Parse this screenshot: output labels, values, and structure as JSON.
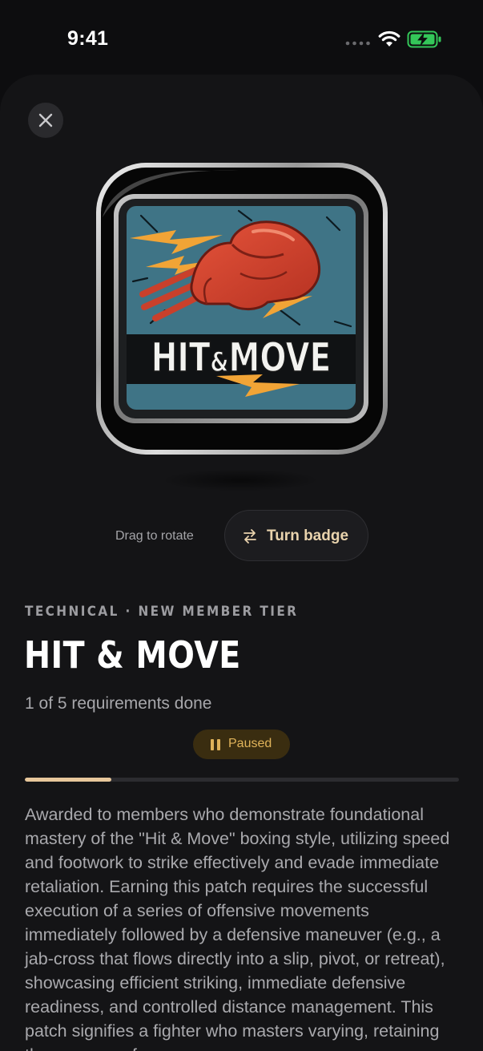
{
  "status_bar": {
    "time": "9:41"
  },
  "close_button": {
    "icon": "close-icon"
  },
  "badge": {
    "text_left": "HIT",
    "text_amp": "&",
    "text_right": "MOVE"
  },
  "rotate": {
    "hint": "Drag to rotate",
    "button_label": "Turn badge",
    "button_icon": "swap-arrows-icon"
  },
  "details": {
    "category": "TECHNICAL · NEW MEMBER TIER",
    "title": "HIT & MOVE",
    "progress_text": "1 of 5 requirements done",
    "progress_fraction": 0.2,
    "status": "Paused",
    "status_icon": "pause-icon",
    "description": "Awarded to members who demonstrate foundational mastery of the \"Hit & Move\" boxing style, utilizing speed and footwork to strike effectively and evade immediate retaliation. Earning this patch requires the successful execution of a series of offensive movements immediately followed by a defensive maneuver (e.g., a jab-cross that flows directly into a slip, pivot, or retreat), showcasing efficient striking, immediate defensive readiness, and controlled distance management. This patch signifies a fighter who masters varying, retaining the essence of"
  },
  "colors": {
    "accent": "#e9d3ad",
    "progress_fill": "#e7c79b",
    "paused_bg": "#3a2d10",
    "paused_text": "#e0b35a",
    "battery": "#34c759"
  }
}
